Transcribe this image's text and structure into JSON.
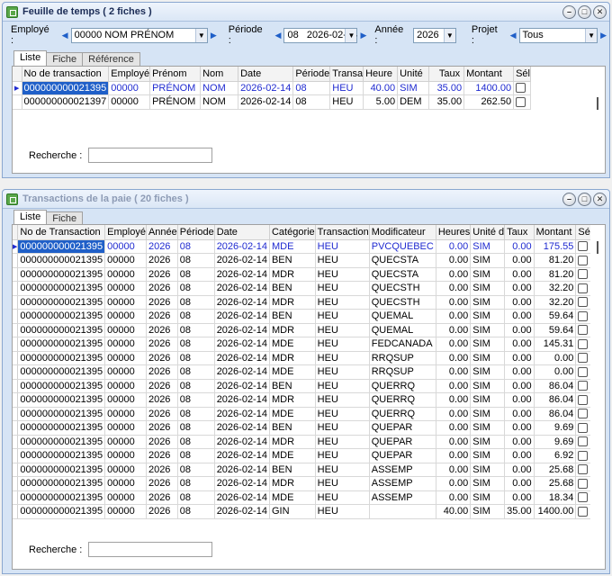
{
  "win1": {
    "title": "Feuille de temps ( 2 fiches )",
    "filters": {
      "employe_label": "Employé :",
      "employe_value": "00000 NOM PRÉNOM",
      "periode_label": "Période :",
      "periode_value": "08   2026-02-14",
      "annee_label": "Année :",
      "annee_value": "2026",
      "projet_label": "Projet :",
      "projet_value": "Tous"
    },
    "tabs": [
      "Liste",
      "Fiche",
      "Référence"
    ],
    "columns": [
      "No de transaction",
      "Employé",
      "Prénom",
      "Nom",
      "Date",
      "Période",
      "Transa",
      "Heure",
      "Unité",
      "Taux",
      "Montant",
      "Sél"
    ],
    "rows": [
      [
        "000000000021395",
        "00000",
        "PRÉNOM",
        "NOM",
        "2026-02-14",
        "08",
        "HEU",
        "40.00",
        "SIM",
        "35.00",
        "1400.00"
      ],
      [
        "000000000021397",
        "00000",
        "PRÉNOM",
        "NOM",
        "2026-02-14",
        "08",
        "HEU",
        "5.00",
        "DEM",
        "35.00",
        "262.50"
      ]
    ],
    "search_label": "Recherche :"
  },
  "win2": {
    "title": "Transactions de la paie ( 20 fiches )",
    "tabs": [
      "Liste",
      "Fiche"
    ],
    "columns": [
      "No de Transaction",
      "Employé",
      "Année",
      "Période",
      "Date",
      "Catégorie",
      "Transaction",
      "Modificateur",
      "Heures",
      "Unité d",
      "Taux",
      "Montant",
      "Sél"
    ],
    "rows": [
      [
        "000000000021395",
        "00000",
        "2026",
        "08",
        "2026-02-14",
        "MDE",
        "HEU",
        "PVCQUEBEC",
        "0.00",
        "SIM",
        "0.00",
        "175.55"
      ],
      [
        "000000000021395",
        "00000",
        "2026",
        "08",
        "2026-02-14",
        "BEN",
        "HEU",
        "QUECSTA",
        "0.00",
        "SIM",
        "0.00",
        "81.20"
      ],
      [
        "000000000021395",
        "00000",
        "2026",
        "08",
        "2026-02-14",
        "MDR",
        "HEU",
        "QUECSTA",
        "0.00",
        "SIM",
        "0.00",
        "81.20"
      ],
      [
        "000000000021395",
        "00000",
        "2026",
        "08",
        "2026-02-14",
        "BEN",
        "HEU",
        "QUECSTH",
        "0.00",
        "SIM",
        "0.00",
        "32.20"
      ],
      [
        "000000000021395",
        "00000",
        "2026",
        "08",
        "2026-02-14",
        "MDR",
        "HEU",
        "QUECSTH",
        "0.00",
        "SIM",
        "0.00",
        "32.20"
      ],
      [
        "000000000021395",
        "00000",
        "2026",
        "08",
        "2026-02-14",
        "BEN",
        "HEU",
        "QUEMAL",
        "0.00",
        "SIM",
        "0.00",
        "59.64"
      ],
      [
        "000000000021395",
        "00000",
        "2026",
        "08",
        "2026-02-14",
        "MDR",
        "HEU",
        "QUEMAL",
        "0.00",
        "SIM",
        "0.00",
        "59.64"
      ],
      [
        "000000000021395",
        "00000",
        "2026",
        "08",
        "2026-02-14",
        "MDE",
        "HEU",
        "FEDCANADA",
        "0.00",
        "SIM",
        "0.00",
        "145.31"
      ],
      [
        "000000000021395",
        "00000",
        "2026",
        "08",
        "2026-02-14",
        "MDR",
        "HEU",
        "RRQSUP",
        "0.00",
        "SIM",
        "0.00",
        "0.00"
      ],
      [
        "000000000021395",
        "00000",
        "2026",
        "08",
        "2026-02-14",
        "MDE",
        "HEU",
        "RRQSUP",
        "0.00",
        "SIM",
        "0.00",
        "0.00"
      ],
      [
        "000000000021395",
        "00000",
        "2026",
        "08",
        "2026-02-14",
        "BEN",
        "HEU",
        "QUERRQ",
        "0.00",
        "SIM",
        "0.00",
        "86.04"
      ],
      [
        "000000000021395",
        "00000",
        "2026",
        "08",
        "2026-02-14",
        "MDR",
        "HEU",
        "QUERRQ",
        "0.00",
        "SIM",
        "0.00",
        "86.04"
      ],
      [
        "000000000021395",
        "00000",
        "2026",
        "08",
        "2026-02-14",
        "MDE",
        "HEU",
        "QUERRQ",
        "0.00",
        "SIM",
        "0.00",
        "86.04"
      ],
      [
        "000000000021395",
        "00000",
        "2026",
        "08",
        "2026-02-14",
        "BEN",
        "HEU",
        "QUEPAR",
        "0.00",
        "SIM",
        "0.00",
        "9.69"
      ],
      [
        "000000000021395",
        "00000",
        "2026",
        "08",
        "2026-02-14",
        "MDR",
        "HEU",
        "QUEPAR",
        "0.00",
        "SIM",
        "0.00",
        "9.69"
      ],
      [
        "000000000021395",
        "00000",
        "2026",
        "08",
        "2026-02-14",
        "MDE",
        "HEU",
        "QUEPAR",
        "0.00",
        "SIM",
        "0.00",
        "6.92"
      ],
      [
        "000000000021395",
        "00000",
        "2026",
        "08",
        "2026-02-14",
        "BEN",
        "HEU",
        "ASSEMP",
        "0.00",
        "SIM",
        "0.00",
        "25.68"
      ],
      [
        "000000000021395",
        "00000",
        "2026",
        "08",
        "2026-02-14",
        "MDR",
        "HEU",
        "ASSEMP",
        "0.00",
        "SIM",
        "0.00",
        "25.68"
      ],
      [
        "000000000021395",
        "00000",
        "2026",
        "08",
        "2026-02-14",
        "MDE",
        "HEU",
        "ASSEMP",
        "0.00",
        "SIM",
        "0.00",
        "18.34"
      ],
      [
        "000000000021395",
        "00000",
        "2026",
        "08",
        "2026-02-14",
        "GIN",
        "HEU",
        "",
        "40.00",
        "SIM",
        "35.00",
        "1400.00"
      ]
    ],
    "search_label": "Recherche :"
  }
}
